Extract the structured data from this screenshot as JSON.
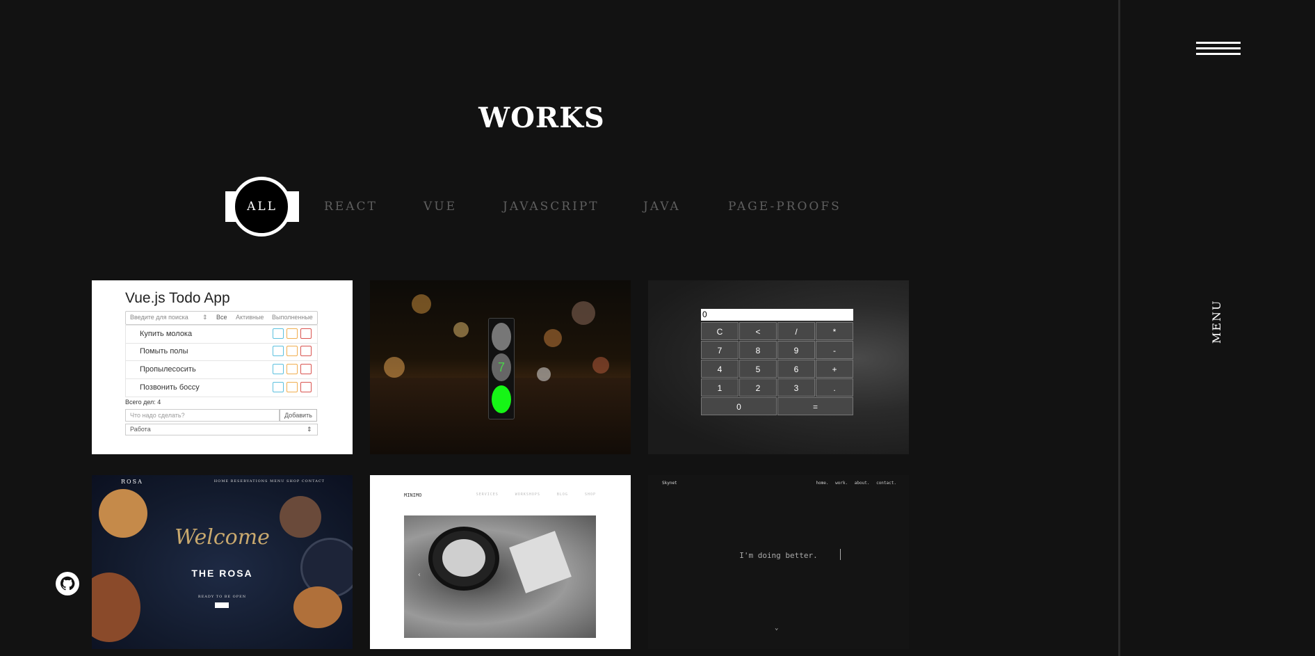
{
  "page": {
    "title": "WORKS",
    "menu_label": "MENU"
  },
  "filters": [
    {
      "label": "ALL",
      "active": true
    },
    {
      "label": "REACT",
      "active": false
    },
    {
      "label": "VUE",
      "active": false
    },
    {
      "label": "JAVASCRIPT",
      "active": false
    },
    {
      "label": "JAVA",
      "active": false
    },
    {
      "label": "PAGE-PROOFS",
      "active": false
    }
  ],
  "icons": {
    "menu": "hamburger-icon",
    "github": "github-icon"
  },
  "cards": {
    "todo": {
      "title": "Vue.js Todo App",
      "search_placeholder": "Введите для поиска",
      "tabs": [
        "Все",
        "Активные",
        "Выполненные"
      ],
      "items": [
        "Купить молока",
        "Помыть полы",
        "Пропылесосить",
        "Позвонить боссу"
      ],
      "count": "Всего дел: 4",
      "add_placeholder": "Что надо сделать?",
      "add_button": "Добавить",
      "category": "Работа"
    },
    "traffic": {
      "counter": "7"
    },
    "calculator": {
      "display": "0",
      "keys": [
        "C",
        "<",
        "/",
        "*",
        "7",
        "8",
        "9",
        "-",
        "4",
        "5",
        "6",
        "+",
        "1",
        "2",
        "3",
        ".",
        "0",
        "="
      ]
    },
    "rosa": {
      "logo": "ROSA",
      "nav": "HOME  RESERVATIONS  MENU  SHOP  CONTACT",
      "welcome": "Welcome",
      "name": "THE ROSA",
      "subtitle": "READY TO BE OPEN"
    },
    "coffee": {
      "brand": "MINIMO",
      "nav": "SERVICES WORKSHOPS BLOG SHOP"
    },
    "skynet": {
      "brand": "Skynet",
      "nav": "home.  work.  about.  contact.",
      "tagline": "I'm doing better.",
      "chevron": "⌄"
    }
  }
}
